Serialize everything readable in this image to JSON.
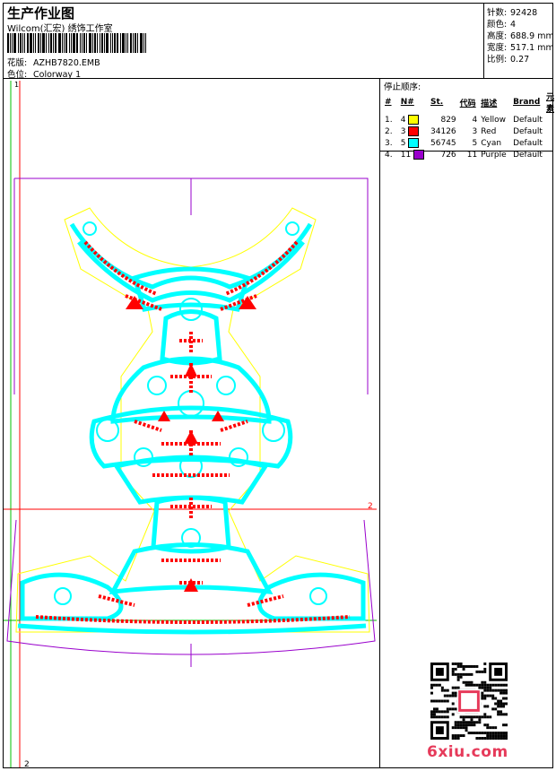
{
  "header": {
    "title": "生产作业图",
    "studio": "Wilcom(汇宏) 绣饰工作室",
    "design_label": "花版:",
    "design_file": "AZHB7820.EMB",
    "colorway_label": "色位:",
    "colorway": "Colorway 1"
  },
  "stats": {
    "stitches_label": "针数:",
    "stitches": "92428",
    "colors_label": "颜色:",
    "colors": "4",
    "height_label": "高度:",
    "height": "688.9 mm",
    "width_label": "宽度:",
    "width": "517.1 mm",
    "scale_label": "比例:",
    "scale": "0.27"
  },
  "stop_sequence": {
    "title": "停止顺序:",
    "headers": [
      "#",
      "N#",
      "St.",
      "代码",
      "描述",
      "Brand",
      "元素"
    ],
    "rows": [
      {
        "idx": "1.",
        "n": "4",
        "color": "#ffff00",
        "st": "829",
        "code": "4",
        "desc": "Yellow",
        "brand": "Default"
      },
      {
        "idx": "2.",
        "n": "3",
        "color": "#ff0000",
        "st": "34126",
        "code": "3",
        "desc": "Red",
        "brand": "Default"
      },
      {
        "idx": "3.",
        "n": "5",
        "color": "#00ffff",
        "st": "56745",
        "code": "5",
        "desc": "Cyan",
        "brand": "Default"
      },
      {
        "idx": "4.",
        "n": "11",
        "color": "#9900cc",
        "st": "726",
        "code": "11",
        "desc": "Purple",
        "brand": "Default"
      }
    ]
  },
  "canvas": {
    "guide_top_left": "1",
    "guide_mid_right": "2",
    "guide_bottom_left": "2"
  },
  "watermark": {
    "text": "6xiu.com"
  },
  "colors": {
    "yellow": "#ffff00",
    "red": "#ff0000",
    "cyan": "#00ffff",
    "purple": "#9900cc",
    "green": "#00c000"
  }
}
